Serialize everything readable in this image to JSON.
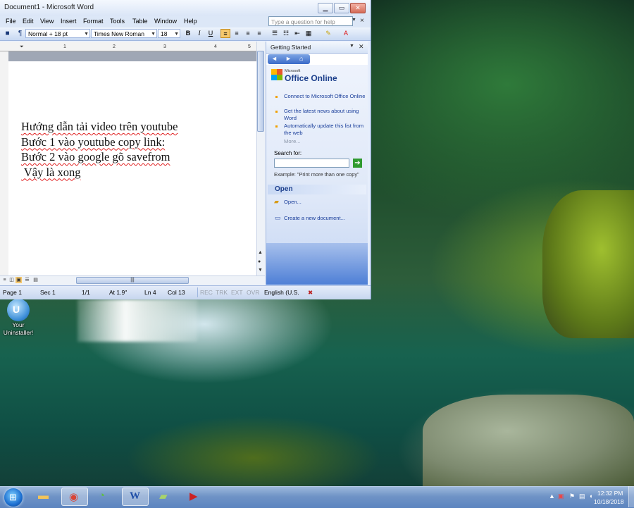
{
  "window": {
    "title": "Document1 - Microsoft Word",
    "min": "▁",
    "max": "▭",
    "close": "✕"
  },
  "menu": {
    "items": [
      "File",
      "Edit",
      "View",
      "Insert",
      "Format",
      "Tools",
      "Table",
      "Window",
      "Help"
    ],
    "help_placeholder": "Type a question for help",
    "doc_close": "×"
  },
  "toolbar": {
    "style": "Normal + 18 pt",
    "font": "Times New Roman",
    "size": "18",
    "bold": "B",
    "italic": "I",
    "underline": "U"
  },
  "ruler": {
    "ticks": [
      "1",
      "2",
      "3",
      "4",
      "5"
    ]
  },
  "document": {
    "lines": [
      "Hướng dẫn tải video trên youtube",
      "Bước 1 vào youtube copy link:",
      "Bước 2 vào google gõ savefrom",
      " Vậy là xong"
    ]
  },
  "status": {
    "page": "Page 1",
    "sec": "Sec 1",
    "pages": "1/1",
    "at": "At 1.9\"",
    "ln": "Ln 4",
    "col": "Col 13",
    "rec": "REC",
    "trk": "TRK",
    "ext": "EXT",
    "ovr": "OVR",
    "lang": "English (U.S."
  },
  "taskpane": {
    "title": "Getting Started",
    "office_small": "Microsoft",
    "office_big": "Office Online",
    "links": [
      "Connect to Microsoft Office Online",
      "Get the latest news about using Word",
      "Automatically update this list from the web"
    ],
    "more": "More...",
    "search_label": "Search for:",
    "example": "Example:  \"Print more than one copy\"",
    "open_section": "Open",
    "open_link": "Open...",
    "create_link": "Create a new document..."
  },
  "desktop_icon": {
    "label": "Your Uninstaller!"
  },
  "taskbar": {
    "time": "12:32 PM",
    "date": "10/18/2018"
  }
}
